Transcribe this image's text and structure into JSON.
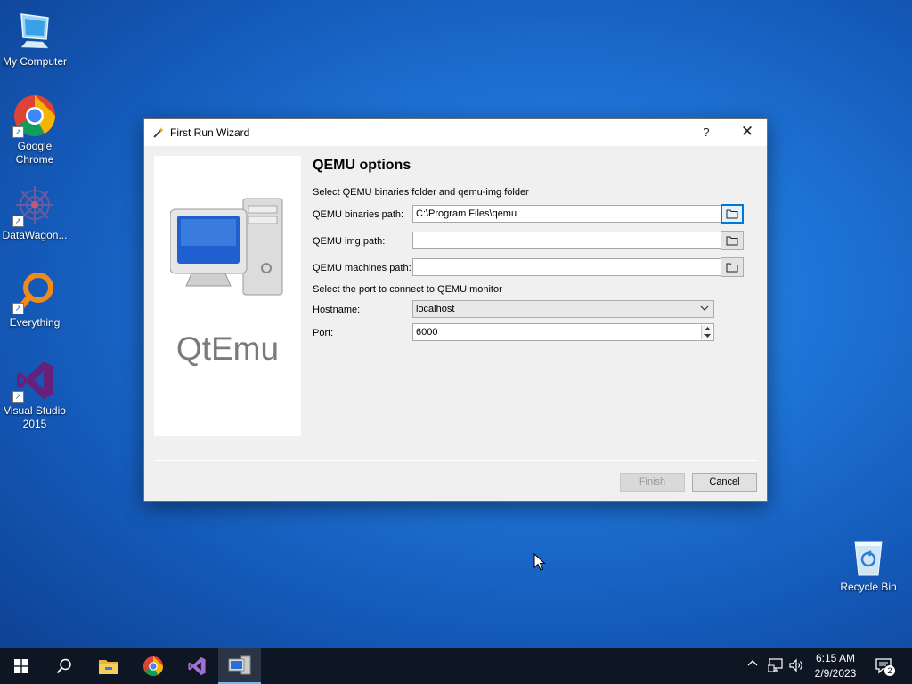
{
  "desktop": {
    "icons": [
      {
        "label": "My Computer"
      },
      {
        "label": "Google Chrome"
      },
      {
        "label": "DataWagon..."
      },
      {
        "label": "Everything"
      },
      {
        "label": "Visual Studio 2015"
      },
      {
        "label": "Recycle Bin"
      }
    ]
  },
  "dialog": {
    "title": "First Run Wizard",
    "help": "?",
    "close": "✕",
    "logo_text": "QtEmu",
    "page_title": "QEMU options",
    "folder_instruction": "Select QEMU binaries folder and qemu-img folder",
    "binaries_label": "QEMU binaries path:",
    "binaries_value": "C:\\Program Files\\qemu",
    "img_label": "QEMU img path:",
    "img_value": "",
    "machines_label": "QEMU machines path:",
    "machines_value": "",
    "port_instruction": "Select the port to connect to QEMU monitor",
    "hostname_label": "Hostname:",
    "hostname_value": "localhost",
    "port_label": "Port:",
    "port_value": "6000",
    "finish_label": "Finish",
    "cancel_label": "Cancel"
  },
  "taskbar": {
    "time": "6:15 AM",
    "date": "2/9/2023",
    "notification_count": "2"
  },
  "colors": {
    "accent": "#0078d7",
    "taskbar": "#0e1624",
    "desktop": "#1e73d6"
  }
}
